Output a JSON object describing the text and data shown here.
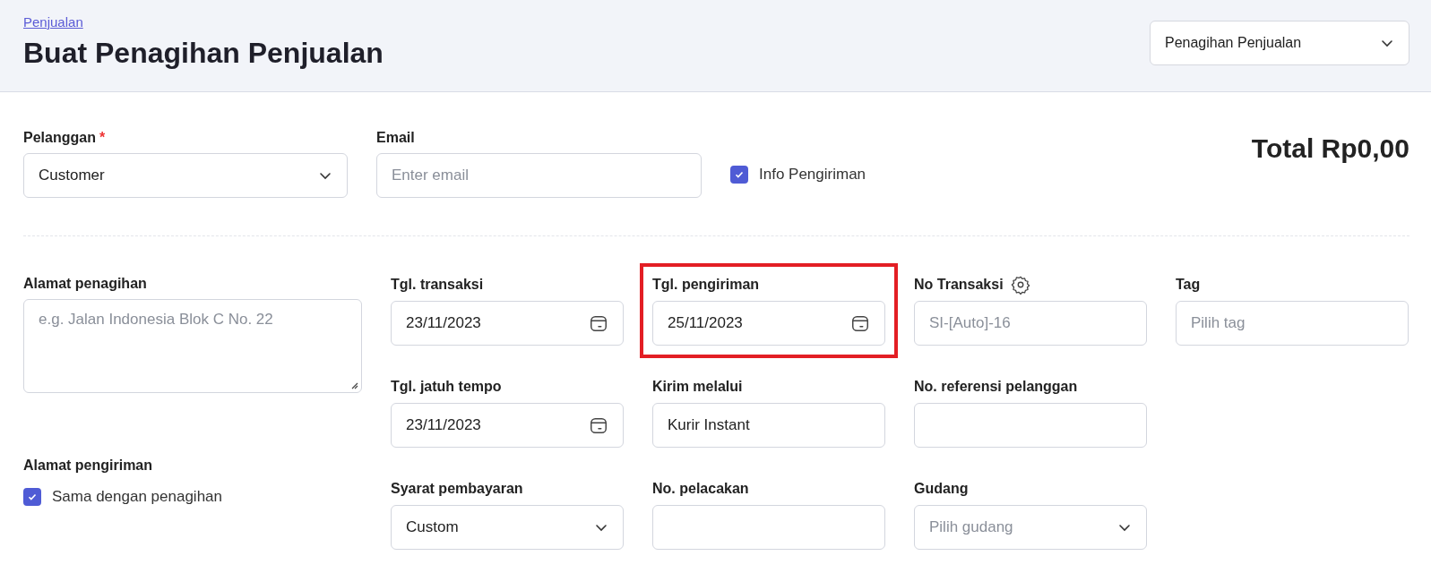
{
  "header": {
    "breadcrumb": "Penjualan",
    "title": "Buat Penagihan Penjualan",
    "doc_type": "Penagihan Penjualan"
  },
  "top": {
    "fields": [
      {
        "label": "Pelanggan",
        "required_mark": "*",
        "kind": "select",
        "value": "Customer"
      },
      {
        "label": "Email",
        "kind": "text",
        "placeholder": "Enter email"
      }
    ],
    "shipping_info": {
      "label": "Info Pengiriman",
      "checked": true
    },
    "total": "Total Rp0,00"
  },
  "billing_address": {
    "label": "Alamat penagihan",
    "placeholder": "e.g. Jalan Indonesia Blok C No. 22"
  },
  "shipping_address": {
    "label": "Alamat pengiriman",
    "same_as_billing": {
      "label": "Sama dengan penagihan",
      "checked": true
    }
  },
  "columns": [
    [
      {
        "label": "Tgl. transaksi",
        "kind": "date",
        "value": "23/11/2023"
      },
      {
        "label": "Tgl. jatuh tempo",
        "kind": "date",
        "value": "23/11/2023"
      },
      {
        "label": "Syarat pembayaran",
        "kind": "select",
        "value": "Custom"
      }
    ],
    [
      {
        "label": "Tgl. pengiriman",
        "kind": "date",
        "value": "25/11/2023",
        "highlighted": true
      },
      {
        "label": "Kirim melalui",
        "kind": "text",
        "value": "Kurir Instant"
      },
      {
        "label": "No. pelacakan",
        "kind": "text"
      }
    ],
    [
      {
        "label": "No Transaksi",
        "kind": "text",
        "placeholder": "SI-[Auto]-16",
        "settings": true
      },
      {
        "label": "No. referensi pelanggan",
        "kind": "text"
      },
      {
        "label": "Gudang",
        "kind": "select",
        "placeholder": "Pilih gudang"
      }
    ],
    [
      {
        "label": "Tag",
        "kind": "text",
        "placeholder": "Pilih tag"
      }
    ]
  ]
}
